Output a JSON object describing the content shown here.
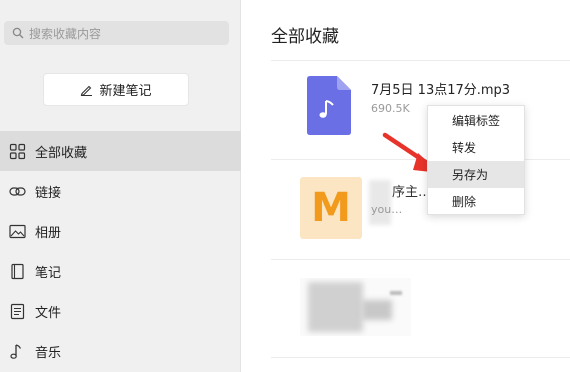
{
  "sidebar": {
    "search_placeholder": "搜索收藏内容",
    "new_note_label": "新建笔记",
    "items": [
      {
        "label": "全部收藏",
        "icon": "grid-icon",
        "active": true
      },
      {
        "label": "链接",
        "icon": "link-icon"
      },
      {
        "label": "相册",
        "icon": "image-icon"
      },
      {
        "label": "笔记",
        "icon": "note-icon"
      },
      {
        "label": "文件",
        "icon": "file-icon"
      },
      {
        "label": "音乐",
        "icon": "music-icon"
      }
    ]
  },
  "main": {
    "title": "全部收藏",
    "items": [
      {
        "name": "7月5日 13点17分.mp3",
        "size": "690.5K",
        "icon": "audio-file-icon"
      },
      {
        "title": "序主…差用…",
        "subtitle": "you…",
        "thumb_letter": "M"
      },
      {
        "thumb": "blurred-image"
      }
    ]
  },
  "context_menu": {
    "items": [
      "编辑标签",
      "转发",
      "另存为",
      "删除"
    ],
    "highlighted": "另存为"
  },
  "colors": {
    "audio_icon": "#6b6fe6",
    "m_thumb_bg": "#fce5c2",
    "m_thumb_fg": "#f19a1c",
    "arrow": "#e8332a"
  }
}
